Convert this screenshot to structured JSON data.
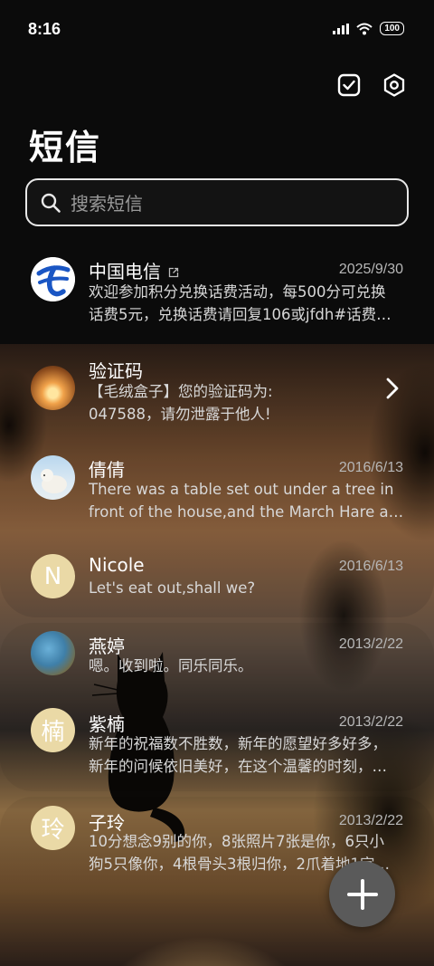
{
  "status": {
    "time": "8:16",
    "battery": "100"
  },
  "header": {
    "title": "短信"
  },
  "search": {
    "placeholder": "搜索短信"
  },
  "conversations": [
    {
      "name": "中国电信",
      "date": "2025/9/30",
      "preview_line1": "欢迎参加积分兑换话费活动，每500分可兑换",
      "preview_line2": "话费5元，兑换话费请回复106或jfdh#话费…",
      "avatar": "china-telecom-logo"
    },
    {
      "name": "验证码",
      "date": "",
      "preview_line1": "【毛绒盒子】您的验证码为:",
      "preview_line2": "047588，请勿泄露于他人!",
      "avatar": "sunset-photo"
    },
    {
      "name": "倩倩",
      "date": "2016/6/13",
      "preview_line1": "There was a table set out under a tree in",
      "preview_line2": "front of the house,and the March Hare an…",
      "avatar": "polar-bear-photo"
    },
    {
      "name": "Nicole",
      "date": "2016/6/13",
      "preview_line1": "Let's eat out,shall we?",
      "preview_line2": "",
      "avatar_letter": "N"
    },
    {
      "name": "燕婷",
      "date": "2013/2/22",
      "preview_line1": "嗯。收到啦。同乐同乐。",
      "preview_line2": "",
      "avatar": "landscape-photo"
    },
    {
      "name": "紫楠",
      "date": "2013/2/22",
      "preview_line1": "新年的祝福数不胜数，新年的愿望好多好多，",
      "preview_line2": "新年的问候依旧美好，在这个温馨的时刻，…",
      "avatar_letter": "楠"
    },
    {
      "name": "子玲",
      "date": "2013/2/22",
      "preview_line1": "10分想念9别的你，8张照片7张是你，6只小",
      "preview_line2": "狗5只像你，4根骨头3根归你，2爪着地1定…",
      "avatar_letter": "玲"
    }
  ],
  "colors": {
    "background": "#0b0b0b",
    "letter_avatar": "#ead9a6",
    "fab": "#5a5a5a"
  }
}
